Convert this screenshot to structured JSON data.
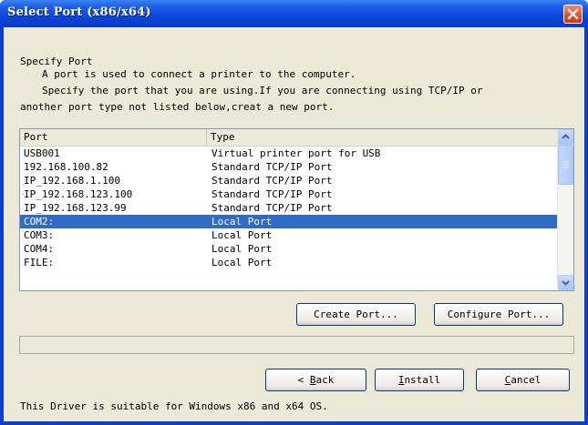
{
  "window": {
    "title": "Select Port (x86/x64)"
  },
  "intro": {
    "heading": "Specify Port",
    "line1": "A port is used to connect a printer to the computer.",
    "line2": "Specify the port that you are using.If you are connecting using TCP/IP or",
    "line3": "another port type not listed below,creat a new port."
  },
  "table": {
    "columns": [
      "Port",
      "Type"
    ],
    "rows": [
      {
        "port": "USB001",
        "type": "Virtual printer port for USB"
      },
      {
        "port": "192.168.100.82",
        "type": "Standard TCP/IP Port"
      },
      {
        "port": "IP_192.168.1.100",
        "type": "Standard TCP/IP Port"
      },
      {
        "port": "IP_192.168.123.100",
        "type": "Standard TCP/IP Port"
      },
      {
        "port": "IP_192.168.123.99",
        "type": "Standard TCP/IP Port"
      },
      {
        "port": "COM2:",
        "type": "Local Port",
        "selected": true
      },
      {
        "port": "COM3:",
        "type": "Local Port"
      },
      {
        "port": "COM4:",
        "type": "Local Port"
      },
      {
        "port": "FILE:",
        "type": "Local Port"
      }
    ]
  },
  "buttons": {
    "create_port": "Create Port...",
    "configure_port": "Configure Port...",
    "back_arrow": "<",
    "back_key": "B",
    "back_rest": "ack",
    "install": "Install",
    "install_key": "I",
    "install_rest": "nstall",
    "cancel_key": "C",
    "cancel_rest": "ancel"
  },
  "footer": {
    "note": "This Driver is suitable for Windows x86 and x64 OS."
  },
  "colors": {
    "titlebar": "#0b45d8",
    "selection": "#316ac5",
    "face": "#ece9d8"
  }
}
